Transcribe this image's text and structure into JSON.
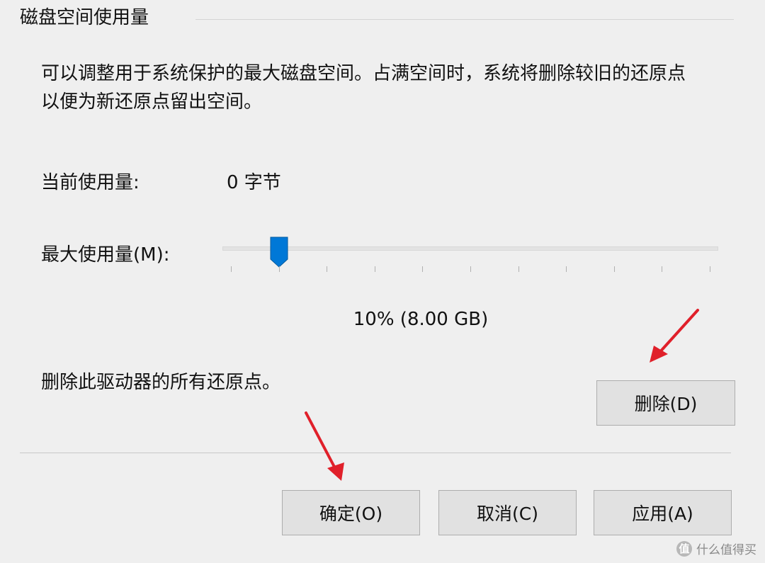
{
  "group": {
    "title": "磁盘空间使用量"
  },
  "description": {
    "line1": "可以调整用于系统保护的最大磁盘空间。占满空间时，系统将删除较旧的还原点",
    "line2": "以便为新还原点留出空间。"
  },
  "current_usage": {
    "label": "当前使用量:",
    "value": "0 字节"
  },
  "max_usage": {
    "label": "最大使用量(M):",
    "slider_percent": 10,
    "tick_count": 11,
    "value_text": "10% (8.00 GB)"
  },
  "delete_section": {
    "text": "删除此驱动器的所有还原点。",
    "delete_button": "删除(D)"
  },
  "footer": {
    "ok_button": "确定(O)",
    "cancel_button": "取消(C)",
    "apply_button": "应用(A)"
  },
  "colors": {
    "background": "#efefef",
    "slider_thumb": "#0078d7",
    "annotation_arrow": "#e0202a"
  },
  "watermark": {
    "logo_glyph": "值",
    "text": "什么值得买"
  }
}
